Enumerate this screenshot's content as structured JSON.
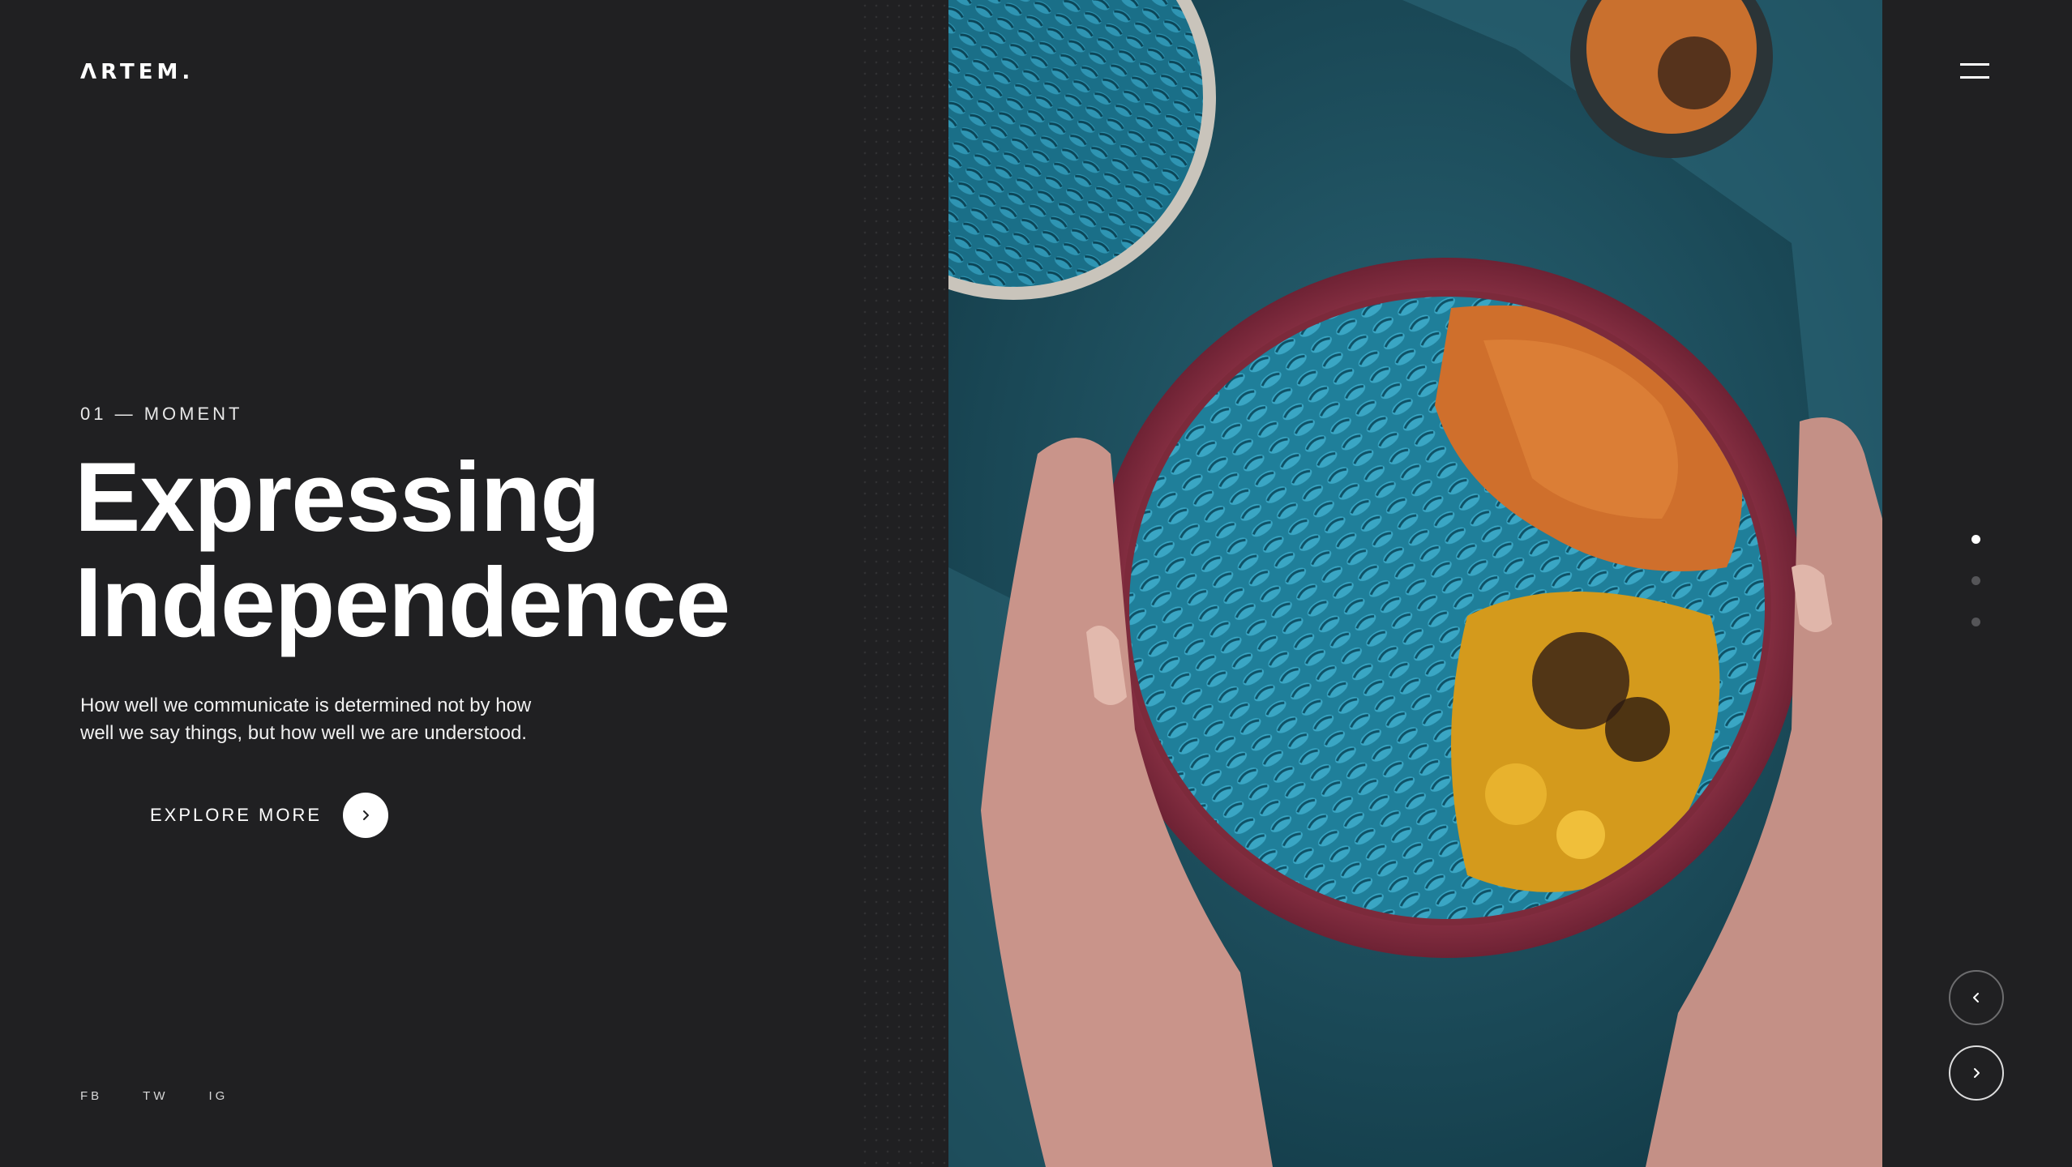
{
  "brand": {
    "logo": "ΛRTEM."
  },
  "slide": {
    "eyebrow": "01 — MOMENT",
    "title_line1": "Expressing",
    "title_line2": "Independence",
    "description": "How well we communicate is determined not by how well we say things, but how well we are understood.",
    "cta_label": "EXPLORE MORE"
  },
  "social": [
    "FB",
    "TW",
    "IG"
  ],
  "pager": {
    "total": 3,
    "active": 1
  },
  "icons": {
    "menu": "hamburger-menu-icon",
    "cta": "chevron-right-icon",
    "prev": "chevron-left-icon",
    "next": "chevron-right-icon"
  },
  "colors": {
    "background": "#202022",
    "text": "#ffffff",
    "inactive_dot": "#555558"
  }
}
